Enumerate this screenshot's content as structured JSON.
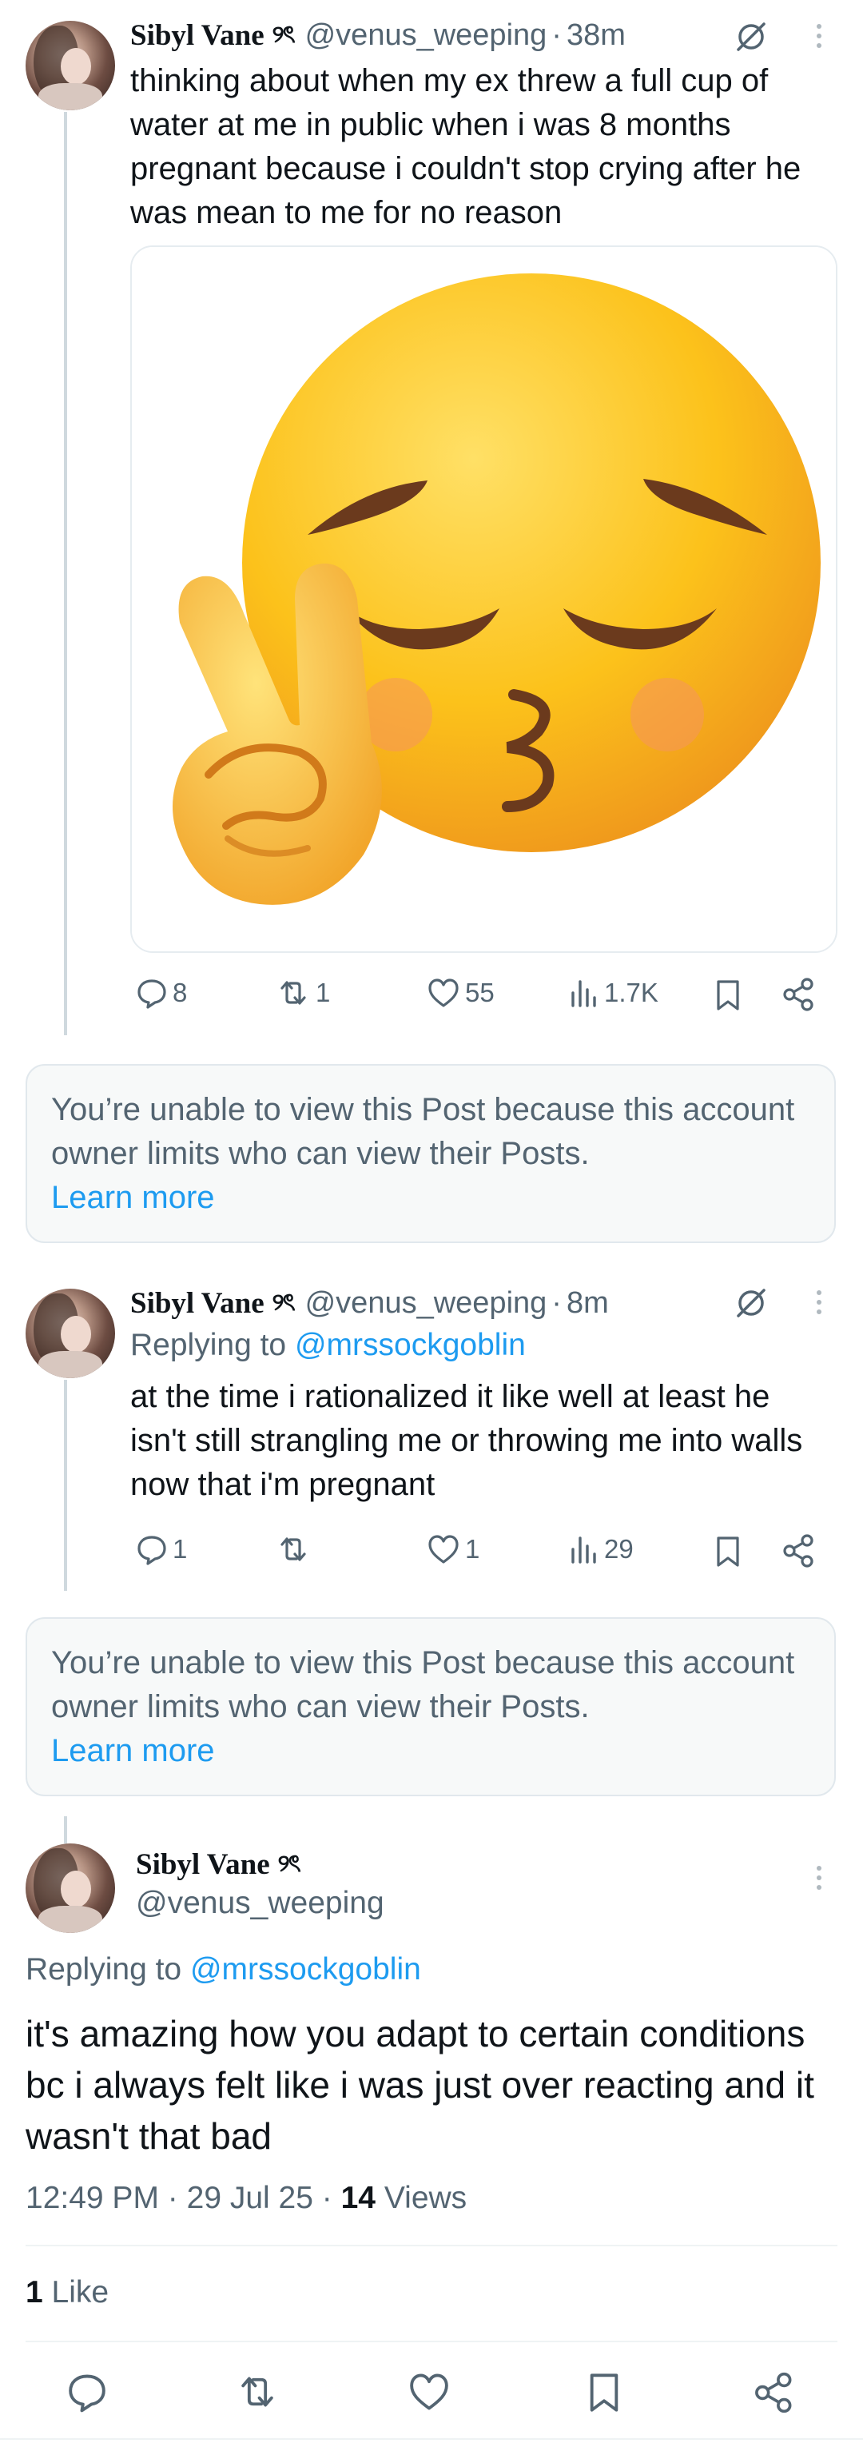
{
  "tweets": [
    {
      "display_name": "Sibyl Vane",
      "badge": "୨ৎ",
      "handle": "@venus_weeping",
      "separator": "·",
      "time": "38m",
      "text": "thinking about when my ex threw a full cup of water at me in public when i was 8 months pregnant because i couldn't stop crying after he was mean to me for no reason",
      "media": "pensive-kiss-peace-sign-emoji",
      "stats": {
        "replies": "8",
        "reposts": "1",
        "likes": "55",
        "views": "1.7K"
      }
    },
    {
      "display_name": "Sibyl Vane",
      "badge": "୨ৎ",
      "handle": "@venus_weeping",
      "separator": "·",
      "time": "8m",
      "replying_prefix": "Replying to",
      "replying_to": "@mrssockgoblin",
      "text": "at the time i rationalized it like well at least he isn't still strangling me or throwing me into walls now that i'm pregnant",
      "stats": {
        "replies": "1",
        "reposts": "",
        "likes": "1",
        "views": "29"
      }
    }
  ],
  "restricted_notice": {
    "message": "You’re unable to view this Post because this account owner limits who can view their Posts.",
    "link": "Learn more"
  },
  "focused_tweet": {
    "display_name": "Sibyl Vane",
    "badge": "୨ৎ",
    "handle": "@venus_weeping",
    "replying_prefix": "Replying to",
    "replying_to": "@mrssockgoblin",
    "text": "it's amazing how you adapt to certain conditions bc i always felt like i was just over reacting and it wasn't that bad",
    "meta_time": "12:49 PM",
    "meta_sep": "·",
    "meta_date": "29 Jul 25",
    "meta_views_count": "14",
    "meta_views_label": "Views",
    "likes_count": "1",
    "likes_label": "Like"
  },
  "icons": {
    "reply": "reply-icon",
    "repost": "repost-icon",
    "like": "heart-icon",
    "views": "views-icon",
    "bookmark": "bookmark-icon",
    "share": "share-icon",
    "more": "more-icon",
    "no-grok": "circle-slash-icon"
  },
  "colors": {
    "accent": "#1d9bf0",
    "secondary_text": "#536471",
    "primary_text": "#0f1419",
    "notice_bg": "#f7f9f9"
  }
}
